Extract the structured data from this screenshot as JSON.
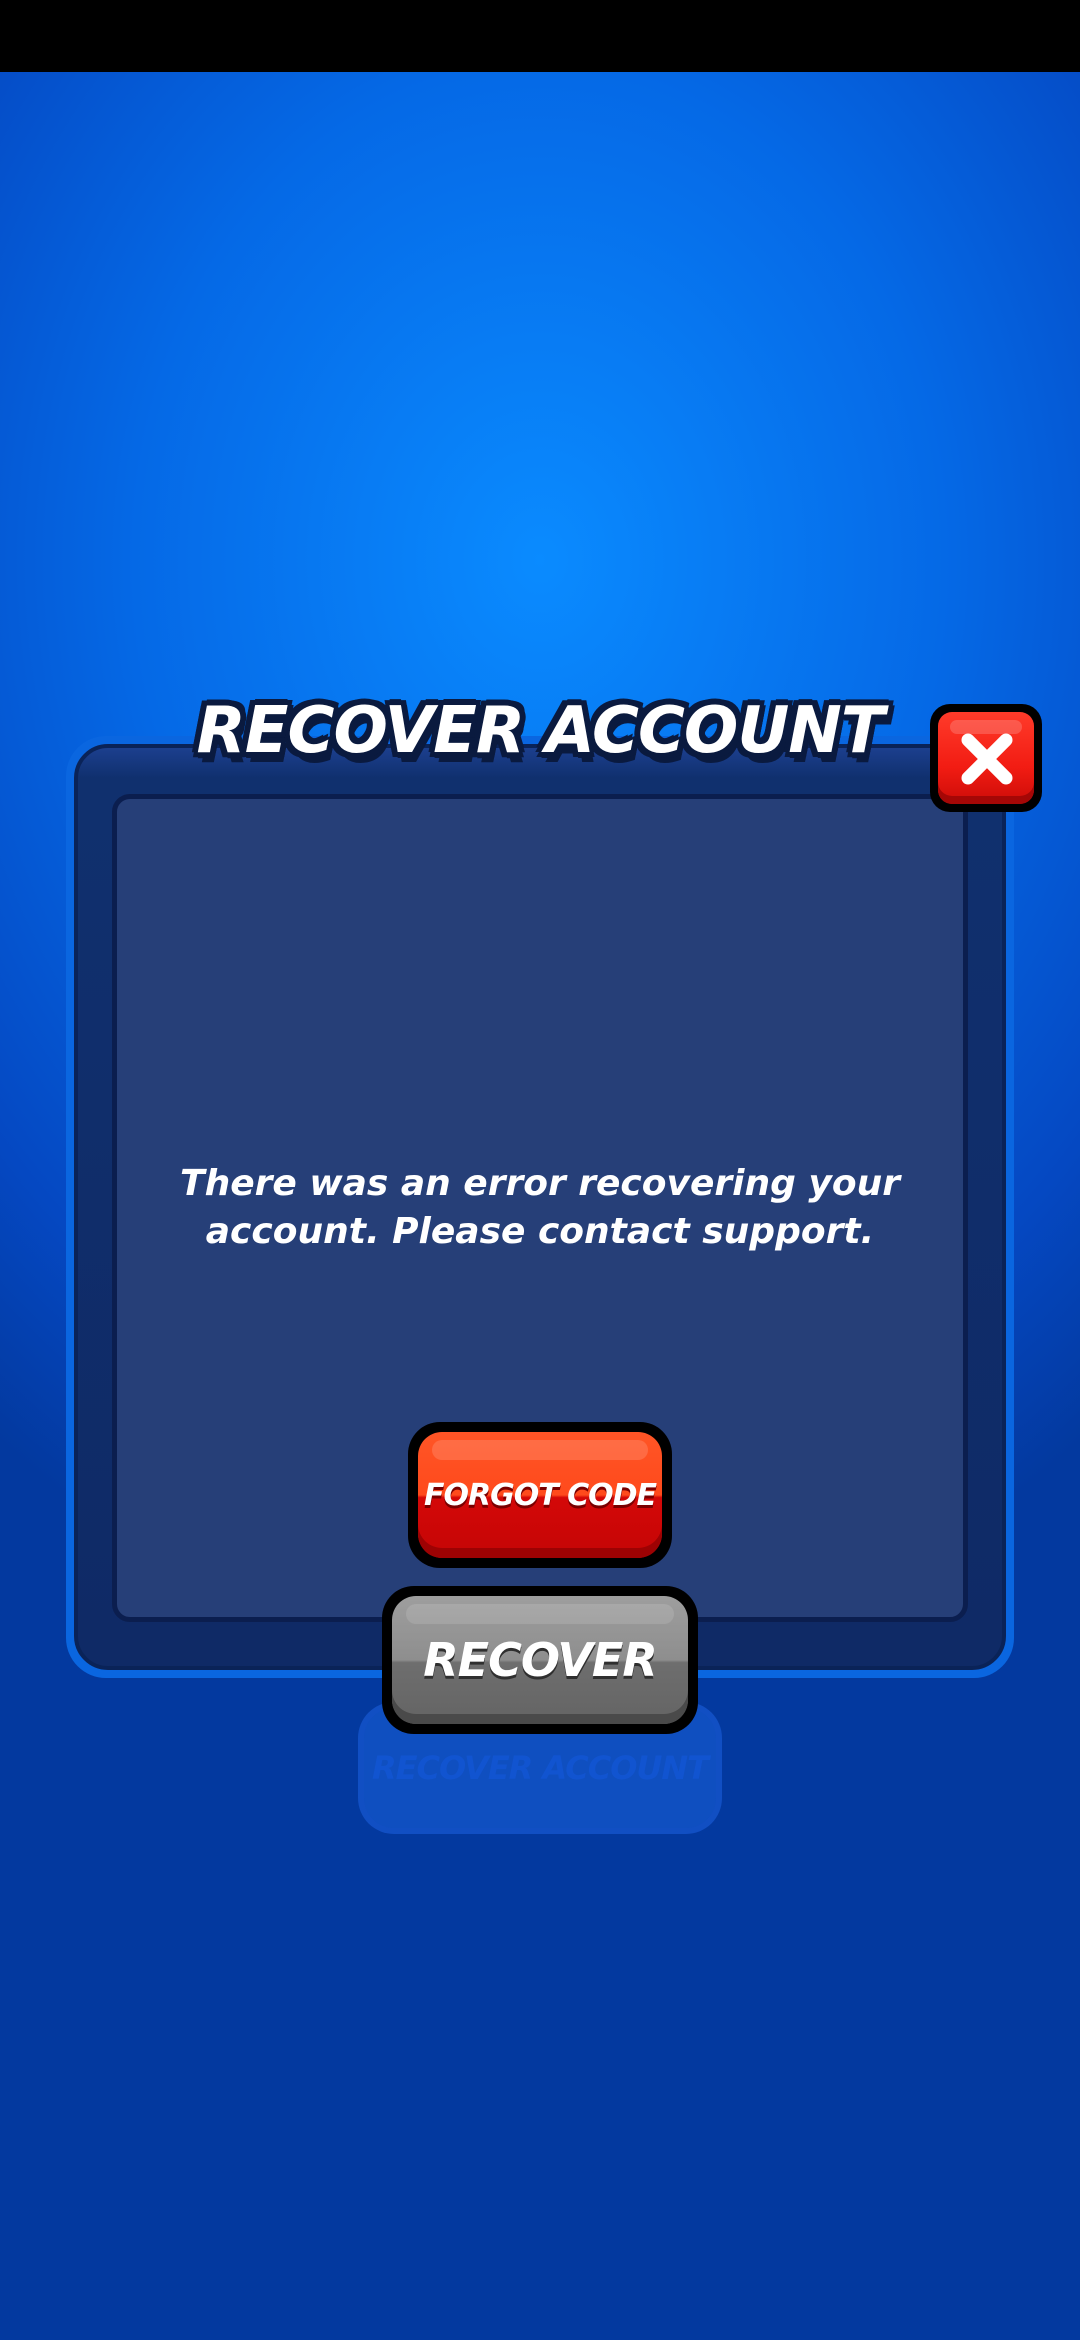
{
  "status_bar": {},
  "background_button": {
    "label": "RECOVER ACCOUNT"
  },
  "dialog": {
    "title": "RECOVER ACCOUNT",
    "message": "There was an error recovering your account. Please contact support.",
    "close_icon": "close-x-icon",
    "buttons": {
      "forgot_code": "FORGOT CODE",
      "recover": "RECOVER"
    }
  },
  "colors": {
    "background": "#0569e6",
    "dialog_frame": "#10306e",
    "dialog_panel": "#263f78",
    "close_button": "#f21c13",
    "forgot_button": "#ff4a1c",
    "recover_button_disabled": "#8e8e8e"
  }
}
